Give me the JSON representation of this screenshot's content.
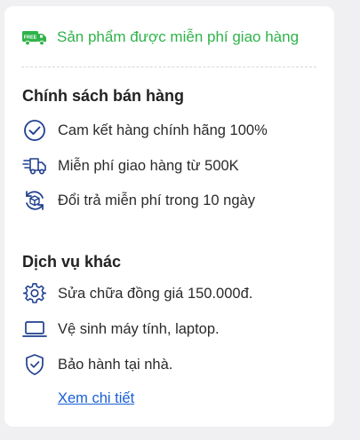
{
  "free_shipping": {
    "badge_text": "FREE",
    "text": "Sản phẩm được miễn phí giao hàng",
    "color": "#2fb34a"
  },
  "policy": {
    "title": "Chính sách bán hàng",
    "items": [
      {
        "icon": "check-circle-icon",
        "label": "Cam kết hàng chính hãng 100%"
      },
      {
        "icon": "delivery-truck-icon",
        "label": "Miễn phí giao hàng từ 500K"
      },
      {
        "icon": "return-refresh-icon",
        "label": "Đổi trả miễn phí trong 10 ngày"
      }
    ]
  },
  "services": {
    "title": "Dịch vụ khác",
    "items": [
      {
        "icon": "gear-icon",
        "label": "Sửa chữa đồng giá 150.000đ."
      },
      {
        "icon": "laptop-icon",
        "label": "Vệ sinh máy tính, laptop."
      },
      {
        "icon": "shield-check-icon",
        "label": "Bảo hành tại nhà."
      }
    ],
    "link_label": "Xem chi tiết"
  },
  "colors": {
    "icon": "#1f3f8f",
    "link": "#1a5fd6"
  }
}
